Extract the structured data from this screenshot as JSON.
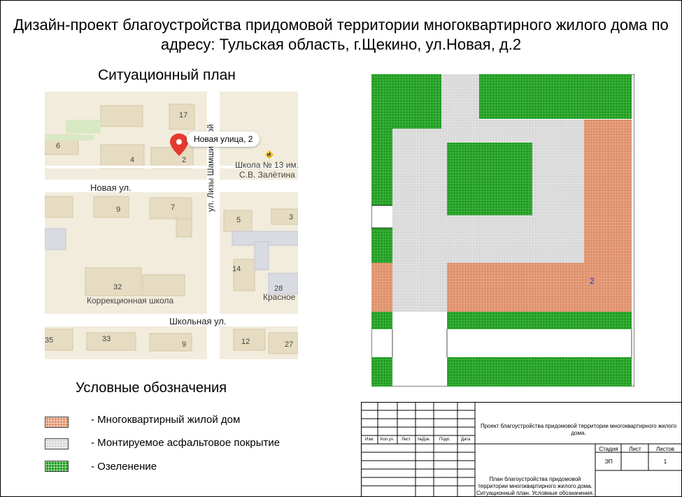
{
  "title": "Дизайн-проект благоустройства придомовой территории многоквартирного жилого дома по адресу: Тульская область, г.Щекино, ул.Новая, д.2",
  "situation_plan": {
    "heading": "Ситуационный план",
    "map": {
      "pin_label": "Новая улица, 2",
      "school_label_1": "Школа № 13 им.",
      "school_label_2": "С.В. Залётина",
      "school_corr_label": "Коррекционная школа",
      "krasnoe_label": "Красное",
      "streets": {
        "novaya": "Новая ул.",
        "shkolnaya": "Школьная ул.",
        "lizy": "ул. Лизы Шамшиковой"
      },
      "house_numbers": [
        "17",
        "6",
        "4",
        "2",
        "9",
        "7",
        "5",
        "3",
        "14",
        "32",
        "28",
        "35",
        "33",
        "9",
        "12",
        "27"
      ]
    }
  },
  "plan": {
    "building_number": "2",
    "colors": {
      "house": "#e0906a",
      "asphalt": "#d8d8d8",
      "green": "#1d9e1d",
      "grid_line": "#ffffff"
    }
  },
  "legend": {
    "title": "Условные обозначения",
    "items": [
      {
        "label": "- Многоквартирный жилой дом",
        "color": "#e0906a"
      },
      {
        "label": "- Монтируемое асфальтовое покрытие",
        "color": "#d8d8d8"
      },
      {
        "label": "- Озеленение",
        "color": "#1d9e1d"
      }
    ]
  },
  "stamp": {
    "col_headers": [
      "Изм.",
      "Кол.уч",
      "Лист",
      "№Док.",
      "Подп.",
      "Дата"
    ],
    "project_title": "Проект благоустройства придомовой территории многоквартирного жилого дома.",
    "stage_header": "Стадия",
    "sheet_header": "Лист",
    "sheets_header": "Листов",
    "stage_value": "ЭП",
    "sheets_value": "1",
    "sheet_title": "План благоустройства придомовой территории многоквартирного жилого дома. Ситуационный план. Условные обозначения."
  }
}
